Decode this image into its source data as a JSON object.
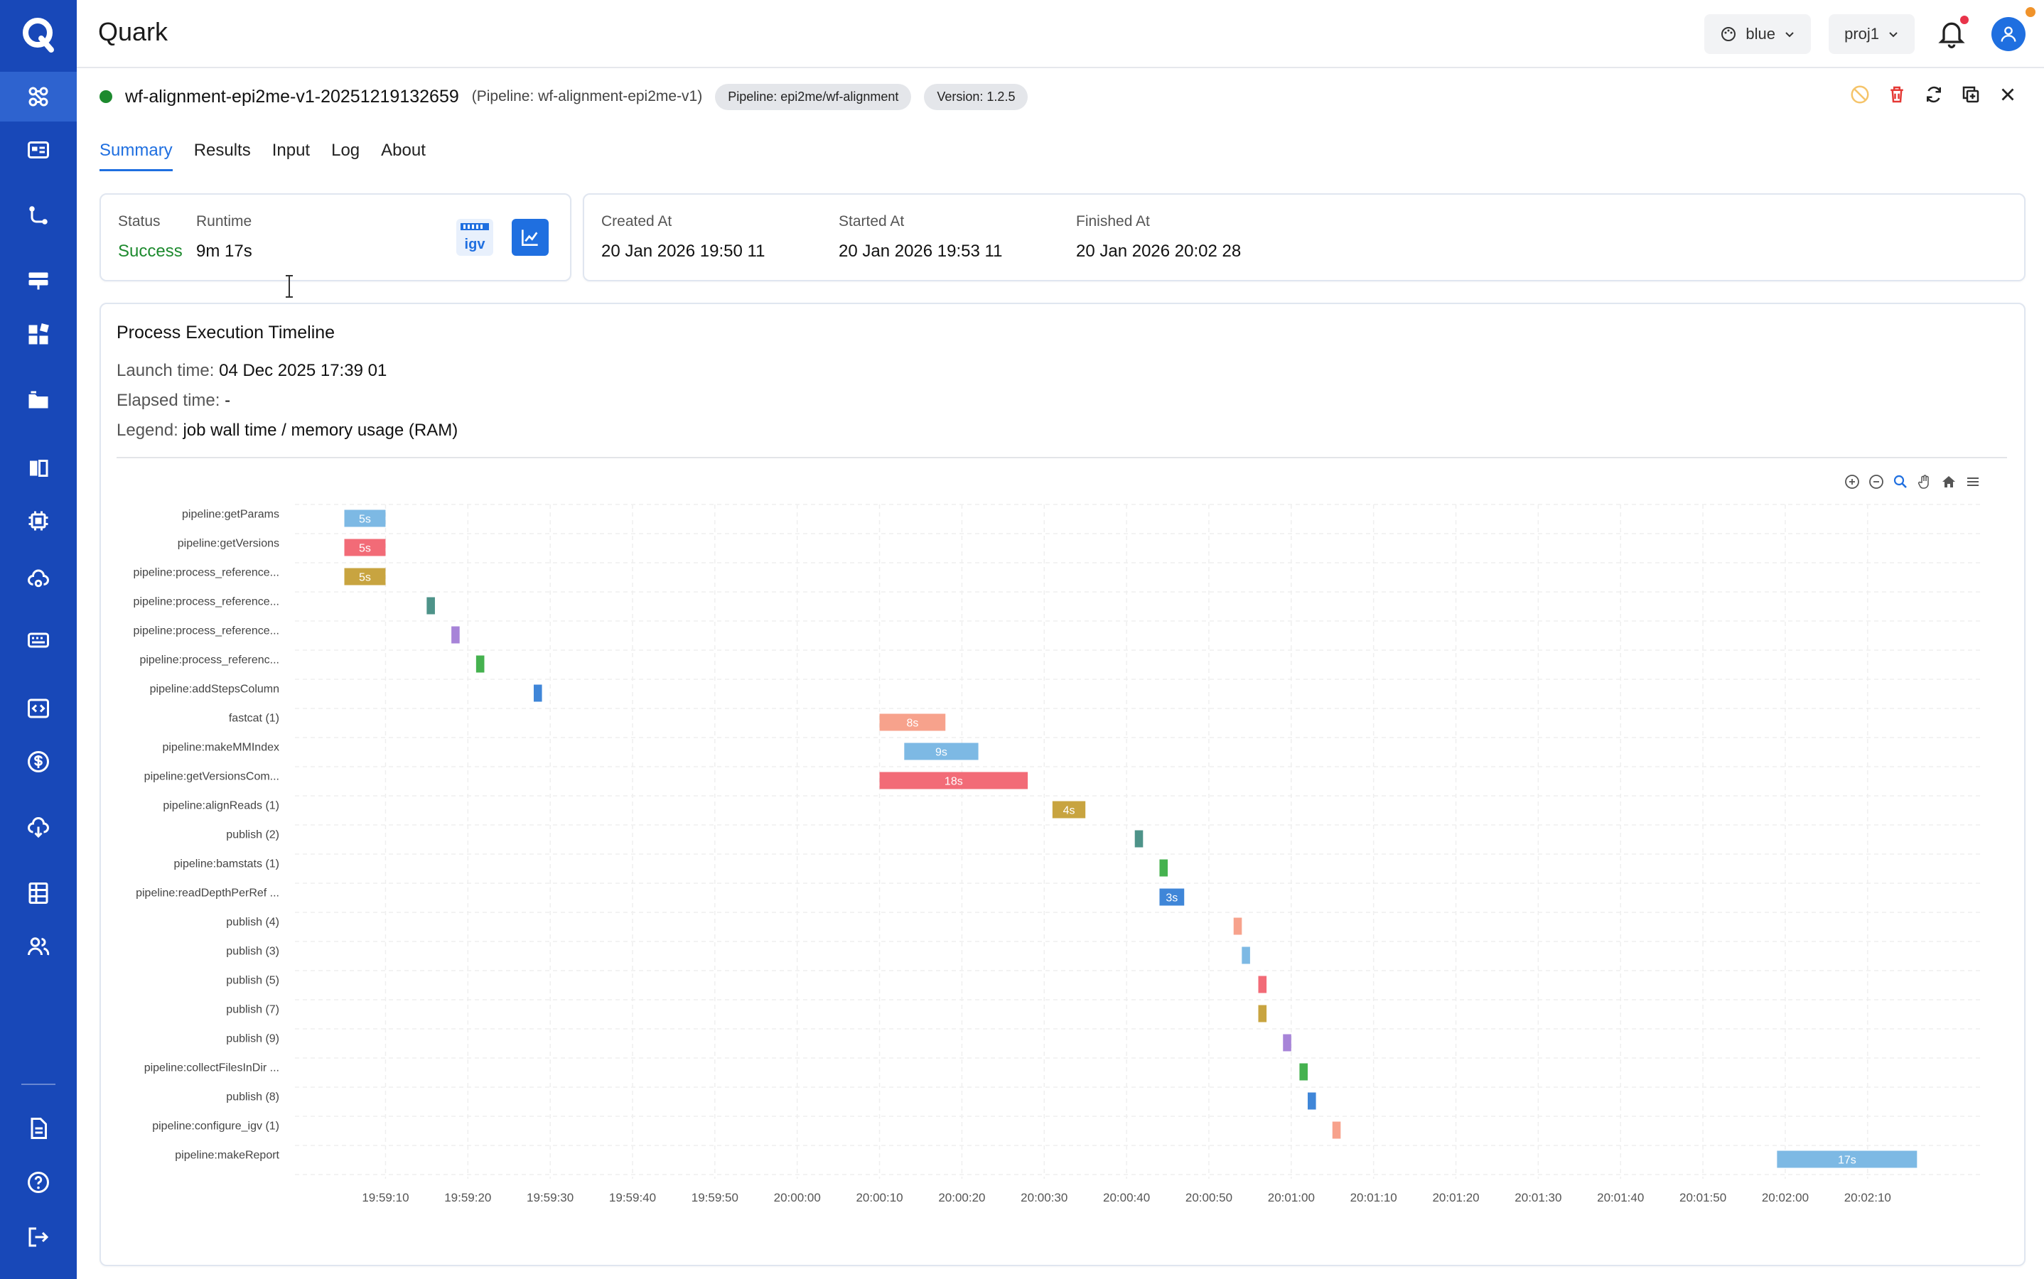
{
  "app": {
    "title": "Quark"
  },
  "header": {
    "theme_label": "blue",
    "project_label": "proj1"
  },
  "colors": {
    "sidebar": "#1848b8",
    "accent": "#1f6fe0",
    "success": "#1d8a2e"
  },
  "sidebar": {
    "items": [
      {
        "icon": "workflow-icon",
        "active": true
      },
      {
        "icon": "dashboard-icon"
      },
      {
        "icon": "pipeline-icon"
      },
      {
        "icon": "server-icon"
      },
      {
        "icon": "apps-icon"
      },
      {
        "icon": "folder-icon"
      },
      {
        "icon": "book-icon"
      },
      {
        "icon": "chip-icon"
      },
      {
        "icon": "cloud-settings-icon"
      },
      {
        "icon": "keyboard-icon"
      },
      {
        "icon": "code-icon"
      },
      {
        "icon": "billing-icon"
      },
      {
        "icon": "cloud-download-icon"
      },
      {
        "icon": "table-icon"
      },
      {
        "icon": "users-icon"
      }
    ],
    "footer": [
      {
        "icon": "document-icon"
      },
      {
        "icon": "help-icon"
      },
      {
        "icon": "logout-icon"
      }
    ]
  },
  "run": {
    "name": "wf-alignment-epi2me-v1-20251219132659",
    "pipeline_note": "(Pipeline: wf-alignment-epi2me-v1)",
    "pipeline_tag": "Pipeline: epi2me/wf-alignment",
    "version_tag": "Version: 1.2.5"
  },
  "tabs": [
    {
      "label": "Summary",
      "active": true
    },
    {
      "label": "Results"
    },
    {
      "label": "Input"
    },
    {
      "label": "Log"
    },
    {
      "label": "About"
    }
  ],
  "summary": {
    "status_label": "Status",
    "status_value": "Success",
    "runtime_label": "Runtime",
    "runtime_value": "9m 17s",
    "igv_label": "igv",
    "created_label": "Created At",
    "created_value": "20 Jan 2026 19:50 11",
    "started_label": "Started At",
    "started_value": "20 Jan 2026 19:53 11",
    "finished_label": "Finished At",
    "finished_value": "20 Jan 2026 20:02 28"
  },
  "timeline": {
    "title": "Process Execution Timeline",
    "launch_label": "Launch time:",
    "launch_value": "04 Dec 2025 17:39 01",
    "elapsed_label": "Elapsed time:",
    "elapsed_value": "-",
    "legend_label": "Legend:",
    "legend_value": "job wall time / memory usage (RAM)"
  },
  "chart_data": {
    "type": "bar",
    "orientation": "horizontal-gantt",
    "x_ticks": [
      "19:59:10",
      "19:59:20",
      "19:59:30",
      "19:59:40",
      "19:59:50",
      "20:00:00",
      "20:00:10",
      "20:00:20",
      "20:00:30",
      "20:00:40",
      "20:00:50",
      "20:01:00",
      "20:01:10",
      "20:01:20",
      "20:01:30",
      "20:01:40",
      "20:01:50",
      "20:02:00",
      "20:02:10"
    ],
    "xlim": [
      "19:58:59",
      "20:02:24"
    ],
    "grid": true,
    "tasks": [
      {
        "label": "pipeline:getParams",
        "start": "19:59:05",
        "end": "19:59:10",
        "bar_label": "5s",
        "color": "#7db9e4"
      },
      {
        "label": "pipeline:getVersions",
        "start": "19:59:05",
        "end": "19:59:10",
        "bar_label": "5s",
        "color": "#f26b77"
      },
      {
        "label": "pipeline:process_reference...",
        "start": "19:59:05",
        "end": "19:59:10",
        "bar_label": "5s",
        "color": "#c8a440"
      },
      {
        "label": "pipeline:process_reference...",
        "start": "19:59:15",
        "end": "19:59:16",
        "bar_label": "",
        "color": "#4e9389"
      },
      {
        "label": "pipeline:process_reference...",
        "start": "19:59:18",
        "end": "19:59:19",
        "bar_label": "",
        "color": "#a784d8"
      },
      {
        "label": "pipeline:process_referenc...",
        "start": "19:59:21",
        "end": "19:59:22",
        "bar_label": "",
        "color": "#45b24f"
      },
      {
        "label": "pipeline:addStepsColumn",
        "start": "19:59:28",
        "end": "19:59:29",
        "bar_label": "",
        "color": "#3f86d8"
      },
      {
        "label": "fastcat (1)",
        "start": "20:00:10",
        "end": "20:00:18",
        "bar_label": "8s",
        "color": "#f7a28c"
      },
      {
        "label": "pipeline:makeMMIndex",
        "start": "20:00:13",
        "end": "20:00:22",
        "bar_label": "9s",
        "color": "#7db9e4"
      },
      {
        "label": "pipeline:getVersionsCom...",
        "start": "20:00:10",
        "end": "20:00:28",
        "bar_label": "18s",
        "color": "#f26b77"
      },
      {
        "label": "pipeline:alignReads (1)",
        "start": "20:00:31",
        "end": "20:00:35",
        "bar_label": "4s",
        "color": "#c8a440"
      },
      {
        "label": "publish (2)",
        "start": "20:00:41",
        "end": "20:00:42",
        "bar_label": "",
        "color": "#4e9389"
      },
      {
        "label": "pipeline:bamstats (1)",
        "start": "20:00:44",
        "end": "20:00:45",
        "bar_label": "",
        "color": "#45b24f"
      },
      {
        "label": "pipeline:readDepthPerRef ...",
        "start": "20:00:44",
        "end": "20:00:47",
        "bar_label": "3s",
        "color": "#3f86d8"
      },
      {
        "label": "publish (4)",
        "start": "20:00:53",
        "end": "20:00:54",
        "bar_label": "",
        "color": "#f7a28c"
      },
      {
        "label": "publish (3)",
        "start": "20:00:54",
        "end": "20:00:55",
        "bar_label": "",
        "color": "#7db9e4"
      },
      {
        "label": "publish (5)",
        "start": "20:00:56",
        "end": "20:00:57",
        "bar_label": "",
        "color": "#f26b77"
      },
      {
        "label": "publish (7)",
        "start": "20:00:56",
        "end": "20:00:57",
        "bar_label": "",
        "color": "#c8a440"
      },
      {
        "label": "publish (9)",
        "start": "20:00:59",
        "end": "20:01:00",
        "bar_label": "",
        "color": "#a784d8"
      },
      {
        "label": "pipeline:collectFilesInDir ...",
        "start": "20:01:01",
        "end": "20:01:02",
        "bar_label": "",
        "color": "#45b24f"
      },
      {
        "label": "publish (8)",
        "start": "20:01:02",
        "end": "20:01:03",
        "bar_label": "",
        "color": "#3f86d8"
      },
      {
        "label": "pipeline:configure_igv (1)",
        "start": "20:01:05",
        "end": "20:01:06",
        "bar_label": "",
        "color": "#f7a28c"
      },
      {
        "label": "pipeline:makeReport",
        "start": "20:01:59",
        "end": "20:02:16",
        "bar_label": "17s",
        "color": "#7db9e4"
      }
    ]
  }
}
